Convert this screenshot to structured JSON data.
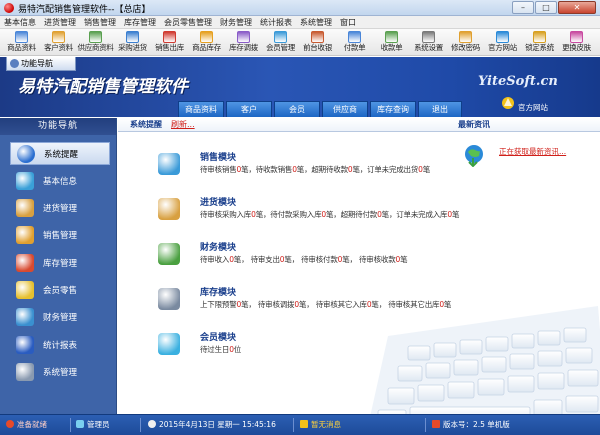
{
  "window": {
    "title": "易特汽配销售管理软件--【总店】",
    "buttons": [
      "–",
      "□",
      "✕"
    ]
  },
  "menu": [
    "基本信息",
    "进货管理",
    "销售管理",
    "库存管理",
    "会员零售管理",
    "财务管理",
    "统计报表",
    "系统管理",
    "窗口"
  ],
  "toolbar": [
    {
      "label": "商品资料",
      "icon": "product-icon",
      "color": "#4a86d8"
    },
    {
      "label": "客户资料",
      "icon": "customer-icon",
      "color": "#e0a030"
    },
    {
      "label": "供应商资料",
      "icon": "supplier-icon",
      "color": "#5aa050"
    },
    {
      "label": "采购进货",
      "icon": "purchase-icon",
      "color": "#3b7fd0"
    },
    {
      "label": "销售出库",
      "icon": "sales-icon",
      "color": "#d03a30"
    },
    {
      "label": "商品库存",
      "icon": "inventory-icon",
      "color": "#e6a020"
    },
    {
      "label": "库存调拨",
      "icon": "transfer-icon",
      "color": "#8a5cc8"
    },
    {
      "label": "会员管理",
      "icon": "member-icon",
      "color": "#3a9ad8"
    },
    {
      "label": "前台收银",
      "icon": "cashier-icon",
      "color": "#c85a30"
    },
    {
      "label": "付款单",
      "icon": "payment-icon",
      "color": "#4a86d8"
    },
    {
      "label": "收款单",
      "icon": "receipt-icon",
      "color": "#5aa050"
    },
    {
      "label": "系统设置",
      "icon": "settings-icon",
      "color": "#7a7a7a"
    },
    {
      "label": "修改密码",
      "icon": "password-icon",
      "color": "#e0a030"
    },
    {
      "label": "官方网站",
      "icon": "website-icon",
      "color": "#2a8ad8"
    },
    {
      "label": "锁定系统",
      "icon": "lock-icon",
      "color": "#d8a020"
    },
    {
      "label": "更换皮肤",
      "icon": "skin-icon",
      "color": "#c84aa0"
    }
  ],
  "banner": {
    "tab": "功能导航",
    "app_title": "易特汽配销售管理软件",
    "brand": "YiteSoft.cn",
    "website": "官方网站",
    "nav_tabs": [
      "商品资料",
      "客户",
      "会员",
      "供应商",
      "库存查询",
      "退出"
    ]
  },
  "sidebar": {
    "header": "功能导航",
    "items": [
      {
        "label": "系统提醒",
        "icon": "info-icon",
        "color": "#2a6ed0"
      },
      {
        "label": "基本信息",
        "icon": "cubes-icon",
        "color": "#3aa0d8"
      },
      {
        "label": "进货管理",
        "icon": "box-in-icon",
        "color": "#d8a040"
      },
      {
        "label": "销售管理",
        "icon": "box-out-icon",
        "color": "#e0a030"
      },
      {
        "label": "库存管理",
        "icon": "warehouse-icon",
        "color": "#d84a30"
      },
      {
        "label": "会员零售",
        "icon": "member-icon",
        "color": "#e6c030"
      },
      {
        "label": "财务管理",
        "icon": "finance-icon",
        "color": "#3a90d0"
      },
      {
        "label": "统计报表",
        "icon": "report-icon",
        "color": "#2a5cc0"
      },
      {
        "label": "系统管理",
        "icon": "gears-icon",
        "color": "#8a9ab0"
      }
    ]
  },
  "main": {
    "tab_label": "系统提醒",
    "refresh": "刷新...",
    "news_header": "最新资讯",
    "news_link": "正在获取最新资讯...",
    "modules": [
      {
        "title": "销售模块",
        "icon": "book-icon",
        "color": "#3a9ad8",
        "parts": [
          [
            "待审核销售",
            "0",
            "笔，待收款销售",
            "0",
            "笔，超期待收款",
            "0",
            "笔，订单未完成出货",
            "0",
            "笔"
          ]
        ]
      },
      {
        "title": "进货模块",
        "icon": "box-icon",
        "color": "#d8a040",
        "parts": [
          [
            "待审核采购入库",
            "0",
            "笔，待付款采购入库",
            "0",
            "笔，超期待付款",
            "0",
            "笔，订单未完成入库",
            "0",
            "笔"
          ]
        ]
      },
      {
        "title": "财务模块",
        "icon": "money-icon",
        "color": "#4aa040",
        "parts": [
          [
            "待审收入",
            "0",
            "笔，  待审支出",
            "0",
            "笔，  待审核付款",
            "0",
            "笔，  待审核收款",
            "0",
            "笔"
          ]
        ]
      },
      {
        "title": "库存模块",
        "icon": "db-icon",
        "color": "#7a8aa0",
        "parts": [
          [
            "上下限预警",
            "0",
            "笔，  待审核调拨",
            "0",
            "笔，  待审核其它入库",
            "0",
            "笔，  待审核其它出库",
            "0",
            "笔"
          ]
        ]
      },
      {
        "title": "会员模块",
        "icon": "chat-icon",
        "color": "#3ab0e0",
        "parts": [
          [
            "待过生日",
            "0",
            "位"
          ]
        ]
      }
    ]
  },
  "status": {
    "ready": "准备就绪",
    "user": "管理员",
    "datetime": "2015年4月13日   星期一     15:45:16",
    "message": "暂无消息",
    "version": "版本号：2.5  单机版"
  }
}
